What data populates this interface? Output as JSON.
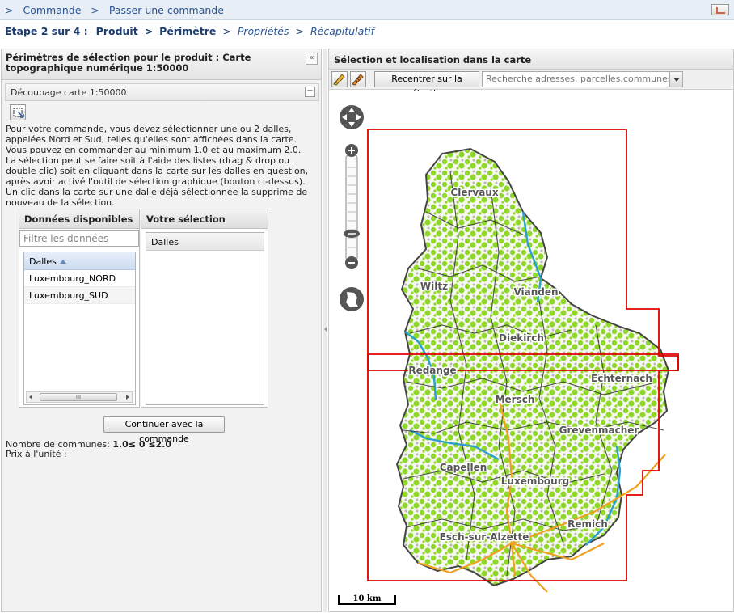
{
  "breadcrumb": {
    "sep": ">",
    "items": [
      "Commande",
      "Passer une commande"
    ]
  },
  "steps": {
    "prefix": "Etape 2 sur 4 :",
    "sep": ">",
    "done": [
      "Produit",
      "Périmètre"
    ],
    "todo": [
      "Propriétés",
      "Récapitulatif"
    ]
  },
  "left_panel": {
    "title": "Périmètres de sélection pour le produit : Carte topographique numérique 1:50000",
    "collapse_glyph": "«",
    "fieldset_title": "Découpage carte 1:50000",
    "fieldset_toggle": "−",
    "instructions": [
      "Pour votre commande, vous devez sélectionner une ou 2 dalles, appelées Nord et Sud, telles qu'elles sont affichées dans la carte. Vous pouvez en commander au minimum 1.0 et au maximum 2.0.",
      "La sélection peut se faire soit à l'aide des listes (drag & drop ou double clic) soit en cliquant dans la carte sur les dalles en question, après avoir activé l'outil de sélection graphique (bouton ci-dessus). Un clic dans la carte sur une dalle déjà sélectionnée la supprime de nouveau de la sélection."
    ],
    "available": {
      "title": "Données disponibles",
      "filter_placeholder": "Filtre les données",
      "column": "Dalles",
      "rows": [
        "Luxembourg_NORD",
        "Luxembourg_SUD"
      ],
      "scroll_thumb": "III"
    },
    "selection": {
      "title": "Votre sélection",
      "column": "Dalles",
      "rows": []
    },
    "continue_label": "Continuer avec la commande",
    "communes_label": "Nombre de communes:",
    "communes_value": "1.0≤ 0 ≤2.0",
    "price_label": "Prix à l'unité :"
  },
  "right_panel": {
    "title": "Sélection et localisation dans la carte",
    "recenter_label": "Recentrer sur la sélection",
    "search_placeholder": "Recherche adresses, parcelles,communes, localités"
  },
  "map": {
    "scale_label": "10 km",
    "places": [
      {
        "name": "Clervaux"
      },
      {
        "name": "Wiltz"
      },
      {
        "name": "Vianden"
      },
      {
        "name": "Diekirch"
      },
      {
        "name": "Redange"
      },
      {
        "name": "Echternach"
      },
      {
        "name": "Mersch"
      },
      {
        "name": "Grevenmacher"
      },
      {
        "name": "Capellen"
      },
      {
        "name": "Luxembourg"
      },
      {
        "name": "Remich"
      },
      {
        "name": "Esch-sur-Alzette"
      }
    ],
    "tiles": [
      "Luxembourg_NORD",
      "Luxembourg_SUD"
    ],
    "colors": {
      "tile_border": "#e00000",
      "forest": "#8fd82a",
      "boundary": "#333333",
      "roads": "#f0a020",
      "water": "#2aa0d0"
    }
  }
}
